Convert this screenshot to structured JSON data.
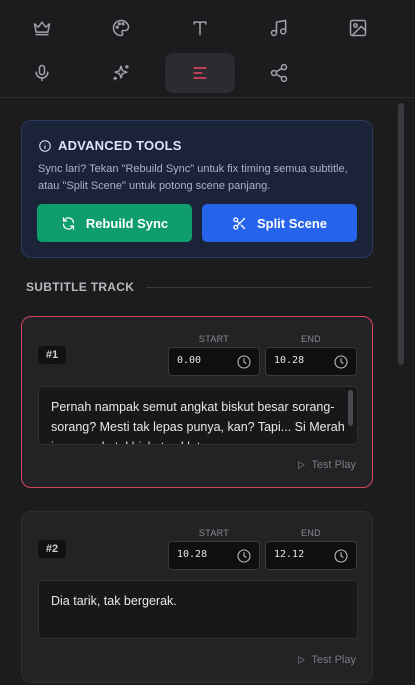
{
  "toolbar": {
    "tools": [
      {
        "icon": "crown-icon"
      },
      {
        "icon": "palette-icon"
      },
      {
        "icon": "text-icon"
      },
      {
        "icon": "music-icon"
      },
      {
        "icon": "image-icon"
      },
      {
        "icon": "microphone-icon"
      },
      {
        "icon": "sparkles-icon"
      },
      {
        "icon": "align-left-icon",
        "active": true
      },
      {
        "icon": "share-icon"
      }
    ],
    "active_color": "#ef4565"
  },
  "advanced": {
    "title": "ADVANCED TOOLS",
    "description": "Sync lari? Tekan \"Rebuild Sync\" untuk fix timing semua subtitle, atau \"Split Scene\" untuk potong scene panjang.",
    "rebuild_label": "Rebuild Sync",
    "split_label": "Split Scene",
    "rebuild_color": "#0f9d6e",
    "split_color": "#2563eb"
  },
  "subtitle_track": {
    "heading": "SUBTITLE TRACK",
    "start_label": "START",
    "end_label": "END",
    "test_play_label": "Test Play",
    "items": [
      {
        "index": "#1",
        "start": "0.00",
        "end": "10.28",
        "text": "Pernah nampak semut angkat biskut besar sorang-sorang? Mesti tak lepas punya, kan? Tapi... Si Merah jumpa seketul biskut coklat",
        "selected": true
      },
      {
        "index": "#2",
        "start": "10.28",
        "end": "12.12",
        "text": "Dia tarik, tak bergerak.",
        "selected": false
      }
    ]
  }
}
